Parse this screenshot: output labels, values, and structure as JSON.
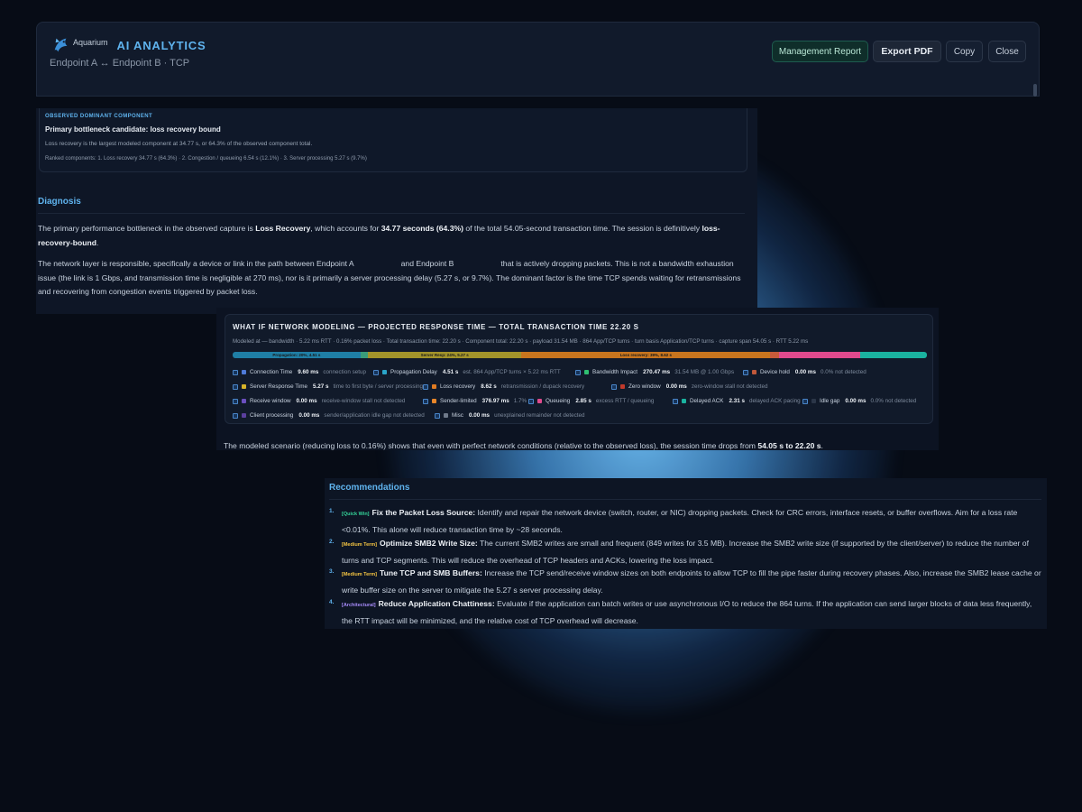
{
  "header": {
    "logo_text": "Aquarium",
    "app_title": "AI ANALYTICS",
    "subtitle": "Endpoint A ↔ Endpoint B · TCP",
    "buttons": {
      "management_report": "Management Report",
      "export_pdf": "Export PDF",
      "copy": "Copy",
      "close": "Close"
    }
  },
  "dominant": {
    "eyebrow": "OBSERVED DOMINANT COMPONENT",
    "title": "Primary bottleneck candidate: loss recovery bound",
    "line1": "Loss recovery is the largest modeled component at 34.77 s, or 64.3% of the observed component total.",
    "line2": "Ranked components: 1. Loss recovery 34.77 s (64.3%) · 2. Congestion / queueing 6.54 s (12.1%) · 3. Server processing 5.27 s (9.7%)"
  },
  "diagnosis": {
    "title": "Diagnosis",
    "p1": {
      "a": "The primary performance bottleneck in the observed capture is ",
      "b": "Loss Recovery",
      "c": ", which accounts for ",
      "d": "34.77 seconds (64.3%)",
      "e": " of the total 54.05-second transaction time. The session is definitively ",
      "f": "loss-recovery-bound",
      "g": "."
    },
    "p2": {
      "a": "The network layer is responsible, specifically a device or link in the path between Endpoint A",
      "b": "and Endpoint B",
      "c": "that is actively dropping packets. This is not a bandwidth exhaustion issue (the link is 1 Gbps, and transmission time is negligible at 270 ms), nor is it primarily a server processing delay (5.27 s, or 9.7%). The dominant factor is the time TCP spends waiting for retransmissions and recovering from congestion events triggered by packet loss."
    }
  },
  "whatif": {
    "title": "WHAT IF NETWORK MODELING — PROJECTED RESPONSE TIME — TOTAL TRANSACTION TIME 22.20 S",
    "meta": "Modeled at — bandwidth · 5.22 ms RTT · 0.16% packet loss · Total transaction time: 22.20 s · Component total: 22.20 s · payload 31.54 MB · 864 App/TCP turns · turn basis Application/TCP turns · capture span 54.05 s · RTT 5.22 ms",
    "bar": [
      {
        "label": "Propagation: 20%, 4.51 s",
        "fraction": 0.2,
        "color": "#1f7fa6"
      },
      {
        "label": "",
        "fraction": 0.012,
        "color": "#3a9d7a"
      },
      {
        "label": "Server Resp: 24%, 5.27 s",
        "fraction": 0.24,
        "color": "#a3942a"
      },
      {
        "label": "Loss recovery: 39%, 8.62 s",
        "fraction": 0.39,
        "color": "#c8751e"
      },
      {
        "label": "",
        "fraction": 0.013,
        "color": "#c75a3a"
      },
      {
        "label": "",
        "fraction": 0.128,
        "color": "#e04a8d"
      },
      {
        "label": "",
        "fraction": 0.104,
        "color": "#1ab3a0"
      }
    ],
    "legend": [
      {
        "label": "Connection Time",
        "value": "9.60 ms",
        "note": "connection setup",
        "color": "#4f7bd8"
      },
      {
        "label": "Propagation Delay",
        "value": "4.51 s",
        "note": "est. 864 App/TCP turns × 5.22 ms RTT",
        "color": "#2aa4c8"
      },
      {
        "label": "Bandwidth Impact",
        "value": "270.47 ms",
        "note": "31.54 MB @ 1.00 Gbps",
        "color": "#2fbf71"
      },
      {
        "label": "Device hold",
        "value": "0.00 ms",
        "note": "0.0%  not detected",
        "color": "#c0583a"
      },
      {
        "label": "Server Response Time",
        "value": "5.27 s",
        "note": "time to first byte / server processing",
        "color": "#d6b32a"
      },
      {
        "label": "Loss recovery",
        "value": "8.62 s",
        "note": "retransmission / dupack recovery",
        "color": "#e07b22"
      },
      {
        "label": "Zero window",
        "value": "0.00 ms",
        "note": "zero-window stall  not detected",
        "color": "#c0392b"
      },
      {
        "label": "Receive window",
        "value": "0.00 ms",
        "note": "receive-window stall  not detected",
        "color": "#6b4fbf"
      },
      {
        "label": "Sender-limited",
        "value": "376.97 ms",
        "note": "1.7%",
        "color": "#e8862a"
      },
      {
        "label": "Queueing",
        "value": "2.85 s",
        "note": "excess RTT / queueing",
        "color": "#e04a8d"
      },
      {
        "label": "Delayed ACK",
        "value": "2.31 s",
        "note": "delayed ACK pacing",
        "color": "#1ab3a0"
      },
      {
        "label": "Idle gap",
        "value": "0.00 ms",
        "note": "0.0%  not detected",
        "color": "#2b3648"
      },
      {
        "label": "Client processing",
        "value": "0.00 ms",
        "note": "sender/application idle gap  not detected",
        "color": "#5b3f9e"
      },
      {
        "label": "Misc",
        "value": "0.00 ms",
        "note": "unexplained remainder  not detected",
        "color": "#6f7a8a"
      }
    ],
    "footer": {
      "a": "The modeled scenario (reducing loss to 0.16%) shows that even with perfect network conditions (relative to the observed loss), the session time drops from ",
      "b": "54.05 s to 22.20 s",
      "c": "."
    }
  },
  "recommendations": {
    "title": "Recommendations",
    "items": [
      {
        "num": "1.",
        "tag": "[Quick Win]",
        "title": "Fix the Packet Loss Source:",
        "text": " Identify and repair the network device (switch, router, or NIC) dropping packets. Check for CRC errors, interface resets, or buffer overflows. Aim for a loss rate <0.01%. This alone will reduce transaction time by ~28 seconds."
      },
      {
        "num": "2.",
        "tag": "[Medium Term]",
        "title": "Optimize SMB2 Write Size:",
        "text": " The current SMB2 writes are small and frequent (849 writes for 3.5 MB). Increase the SMB2 write size (if supported by the client/server) to reduce the number of turns and TCP segments. This will reduce the overhead of TCP headers and ACKs, lowering the loss impact."
      },
      {
        "num": "3.",
        "tag": "[Medium Term]",
        "title": "Tune TCP and SMB Buffers:",
        "text": " Increase the TCP send/receive window sizes on both endpoints to allow TCP to fill the pipe faster during recovery phases. Also, increase the SMB2 lease cache or write buffer size on the server to mitigate the 5.27 s server processing delay."
      },
      {
        "num": "4.",
        "tag": "[Architectural]",
        "title": "Reduce Application Chattiness:",
        "text": " Evaluate if the application can batch writes or use asynchronous I/O to reduce the 864 turns. If the application can send larger blocks of data less frequently, the RTT impact will be minimized, and the relative cost of TCP overhead will decrease."
      }
    ]
  }
}
